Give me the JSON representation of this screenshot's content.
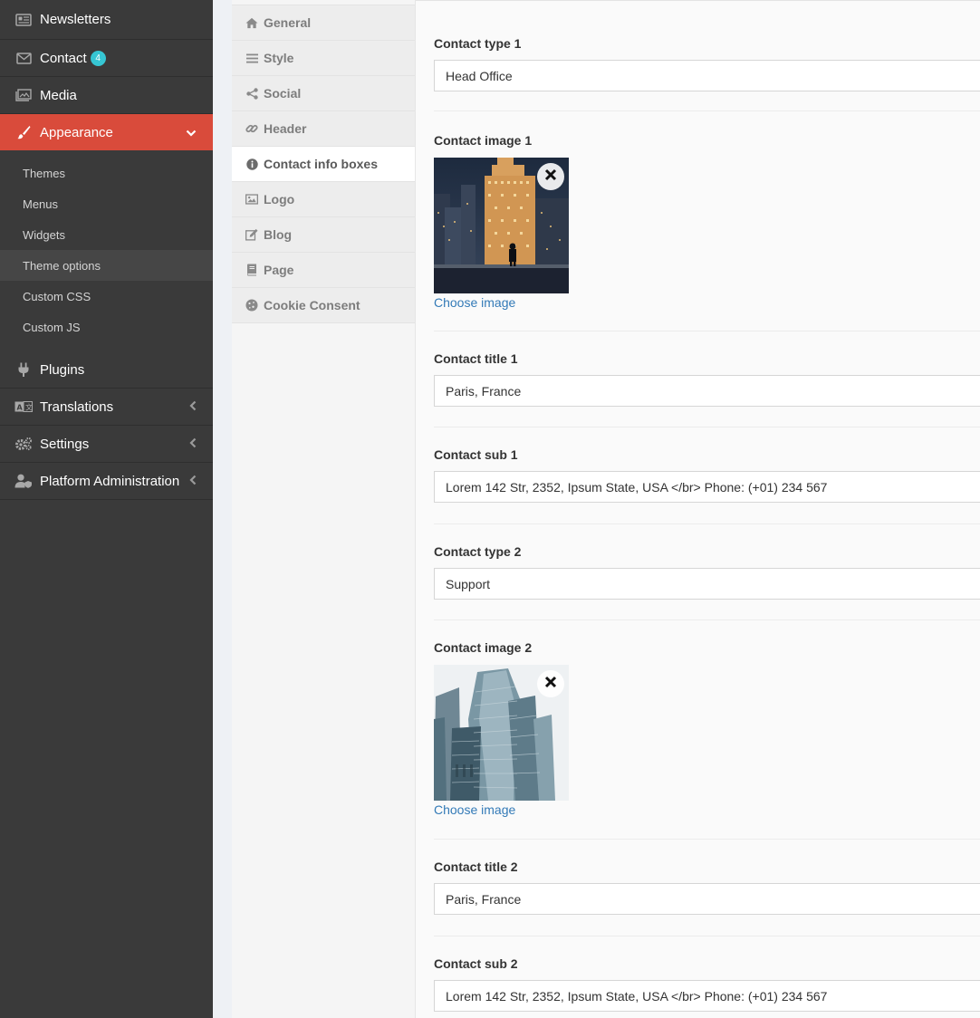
{
  "sidebar": {
    "items_top": [
      {
        "label": "Newsletters",
        "icon": "newspaper-icon"
      },
      {
        "label": "Contact",
        "icon": "envelope-icon",
        "badge": "4"
      },
      {
        "label": "Media",
        "icon": "images-icon"
      }
    ],
    "active": {
      "label": "Appearance",
      "icon": "paint-brush-icon"
    },
    "sub_items": [
      "Themes",
      "Menus",
      "Widgets",
      "Theme options",
      "Custom CSS",
      "Custom JS"
    ],
    "items_bottom": [
      {
        "label": "Plugins",
        "icon": "plug-icon"
      },
      {
        "label": "Translations",
        "icon": "language-icon"
      },
      {
        "label": "Settings",
        "icon": "cogs-icon"
      },
      {
        "label": "Platform Administration",
        "icon": "user-shield-icon"
      }
    ]
  },
  "tabs": [
    {
      "label": "General",
      "icon": "home-icon"
    },
    {
      "label": "Style",
      "icon": "bars-icon"
    },
    {
      "label": "Social",
      "icon": "share-icon"
    },
    {
      "label": "Header",
      "icon": "link-icon"
    },
    {
      "label": "Contact info boxes",
      "icon": "info-circle-icon"
    },
    {
      "label": "Logo",
      "icon": "image-icon"
    },
    {
      "label": "Blog",
      "icon": "edit-icon"
    },
    {
      "label": "Page",
      "icon": "book-icon"
    },
    {
      "label": "Cookie Consent",
      "icon": "cookie-icon"
    }
  ],
  "form": {
    "type1": {
      "label": "Contact type 1",
      "value": "Head Office"
    },
    "image1": {
      "label": "Contact image 1",
      "choose": "Choose image"
    },
    "title1": {
      "label": "Contact title 1",
      "value": "Paris, France"
    },
    "sub1": {
      "label": "Contact sub 1",
      "value": "Lorem 142 Str, 2352, Ipsum State, USA </br> Phone: (+01) 234 567"
    },
    "type2": {
      "label": "Contact type 2",
      "value": "Support"
    },
    "image2": {
      "label": "Contact image 2",
      "choose": "Choose image"
    },
    "title2": {
      "label": "Contact title 2",
      "value": "Paris, France"
    },
    "sub2": {
      "label": "Contact sub 2",
      "value": "Lorem 142 Str, 2352, Ipsum State, USA </br> Phone: (+01) 234 567"
    }
  }
}
